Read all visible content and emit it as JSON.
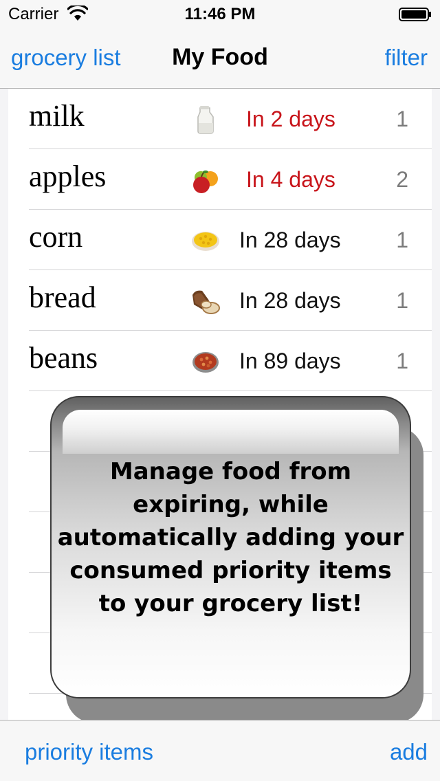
{
  "status_bar": {
    "carrier": "Carrier",
    "time": "11:46 PM"
  },
  "nav": {
    "left": "grocery list",
    "title": "My Food",
    "right": "filter"
  },
  "items": [
    {
      "name": "milk",
      "icon": "milk-jug-icon",
      "expires": "In 2 days",
      "qty": "1",
      "soon": true
    },
    {
      "name": "apples",
      "icon": "apples-icon",
      "expires": "In 4 days",
      "qty": "2",
      "soon": true
    },
    {
      "name": "corn",
      "icon": "corn-bowl-icon",
      "expires": "In 28 days",
      "qty": "1",
      "soon": false
    },
    {
      "name": "bread",
      "icon": "bread-loaf-icon",
      "expires": "In 28 days",
      "qty": "1",
      "soon": false
    },
    {
      "name": "beans",
      "icon": "beans-bowl-icon",
      "expires": "In 89 days",
      "qty": "1",
      "soon": false
    }
  ],
  "tutorial": {
    "message": "Manage food from expiring, while automatically adding your consumed priority items to your grocery list!"
  },
  "toolbar": {
    "left": "priority items",
    "right": "add"
  },
  "colors": {
    "accent": "#1a7de0",
    "expiring_soon": "#c8151b"
  }
}
